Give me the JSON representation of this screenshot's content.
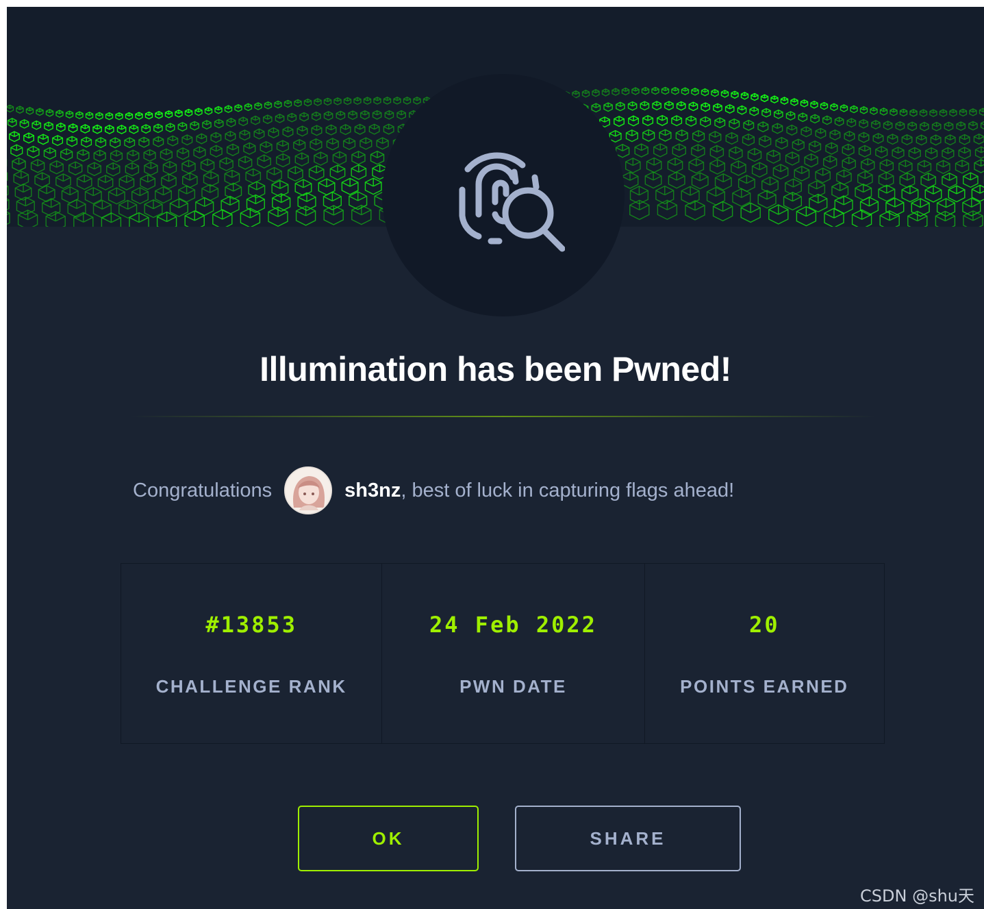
{
  "dialog": {
    "title": "Illumination has been Pwned!",
    "badge_icon": "fingerprint-search-icon"
  },
  "congrats": {
    "prefix": "Congratulations",
    "username": "sh3nz",
    "suffix": ", best of luck in capturing flags ahead!"
  },
  "stats": [
    {
      "value": "#13853",
      "label": "CHALLENGE RANK"
    },
    {
      "value": "24 Feb 2022",
      "label": "PWN DATE"
    },
    {
      "value": "20",
      "label": "POINTS EARNED"
    }
  ],
  "buttons": {
    "ok": "OK",
    "share": "SHARE"
  },
  "watermark": "CSDN @shu天",
  "colors": {
    "accent": "#9fef00",
    "background": "#1a2332",
    "muted_text": "#a4b1cd"
  }
}
